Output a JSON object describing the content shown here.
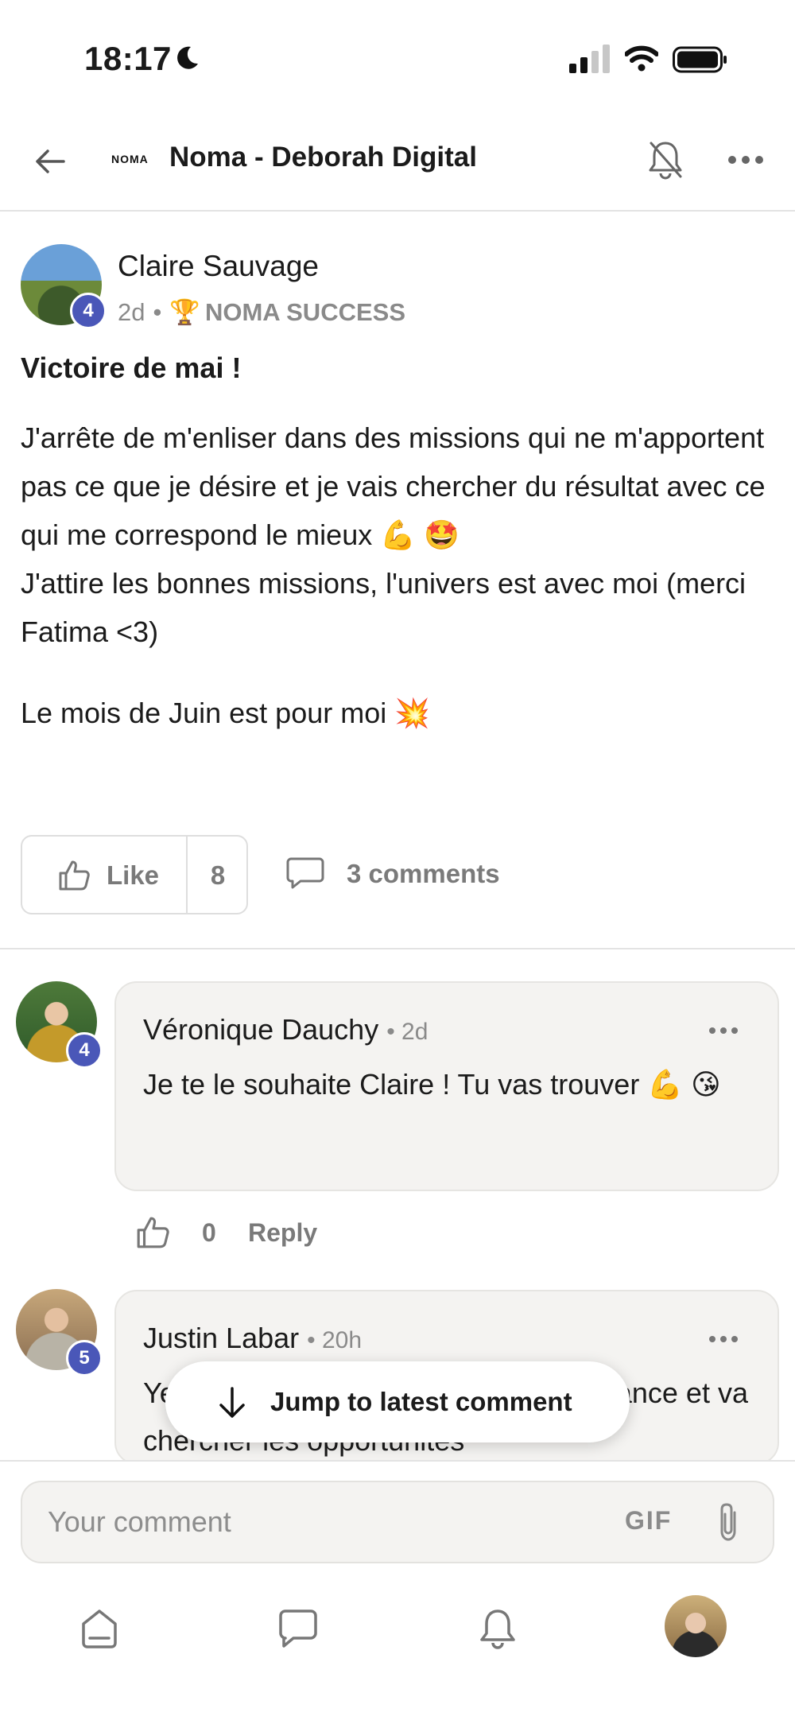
{
  "status_bar": {
    "time": "18:17",
    "icons": [
      "moon-icon",
      "cellular-signal-icon",
      "wifi-icon",
      "battery-icon"
    ]
  },
  "header": {
    "brand_logo": "NOMA",
    "title": "Noma - Deborah Digital",
    "icons": [
      "back-arrow-icon",
      "bell-off-icon",
      "more-icon"
    ]
  },
  "post": {
    "author": "Claire Sauvage",
    "author_level": "4",
    "time": "2d",
    "separator": "•",
    "category_emoji": "🏆",
    "category": "NOMA SUCCESS",
    "title": "Victoire de mai !",
    "body": {
      "line1": "J'arrête de m'enliser dans des missions qui ne m'apportent pas ce que je désire et je vais chercher du résultat avec ce qui me correspond le mieux 💪 🤩",
      "line2": "J'attire les bonnes missions, l'univers est avec moi (merci Fatima <3)",
      "line3": "Le mois de Juin est pour moi 💥"
    },
    "like_label": "Like",
    "like_count": "8",
    "comments_label": "3 comments"
  },
  "comments": [
    {
      "author": "Véronique Dauchy",
      "level": "4",
      "time": "• 2d",
      "text": "Je te le souhaite Claire ! Tu vas trouver 💪 😘",
      "like_count": "0",
      "reply_label": "Reply"
    },
    {
      "author": "Justin Labar",
      "level": "5",
      "time": "• 20h",
      "text_visible": "Ye                                        s-toi confiance et va chercher les opportunités"
    }
  ],
  "jump_button": {
    "label": "Jump to latest comment"
  },
  "composer": {
    "placeholder": "Your comment",
    "gif_label": "GIF"
  },
  "bottom_nav": {
    "items": [
      "home-icon",
      "chat-icon",
      "notifications-icon",
      "profile-avatar"
    ]
  },
  "colors": {
    "level_badge": "#4a57b8",
    "muted_text": "#8a8a8a",
    "bubble_bg": "#f4f3f1"
  }
}
